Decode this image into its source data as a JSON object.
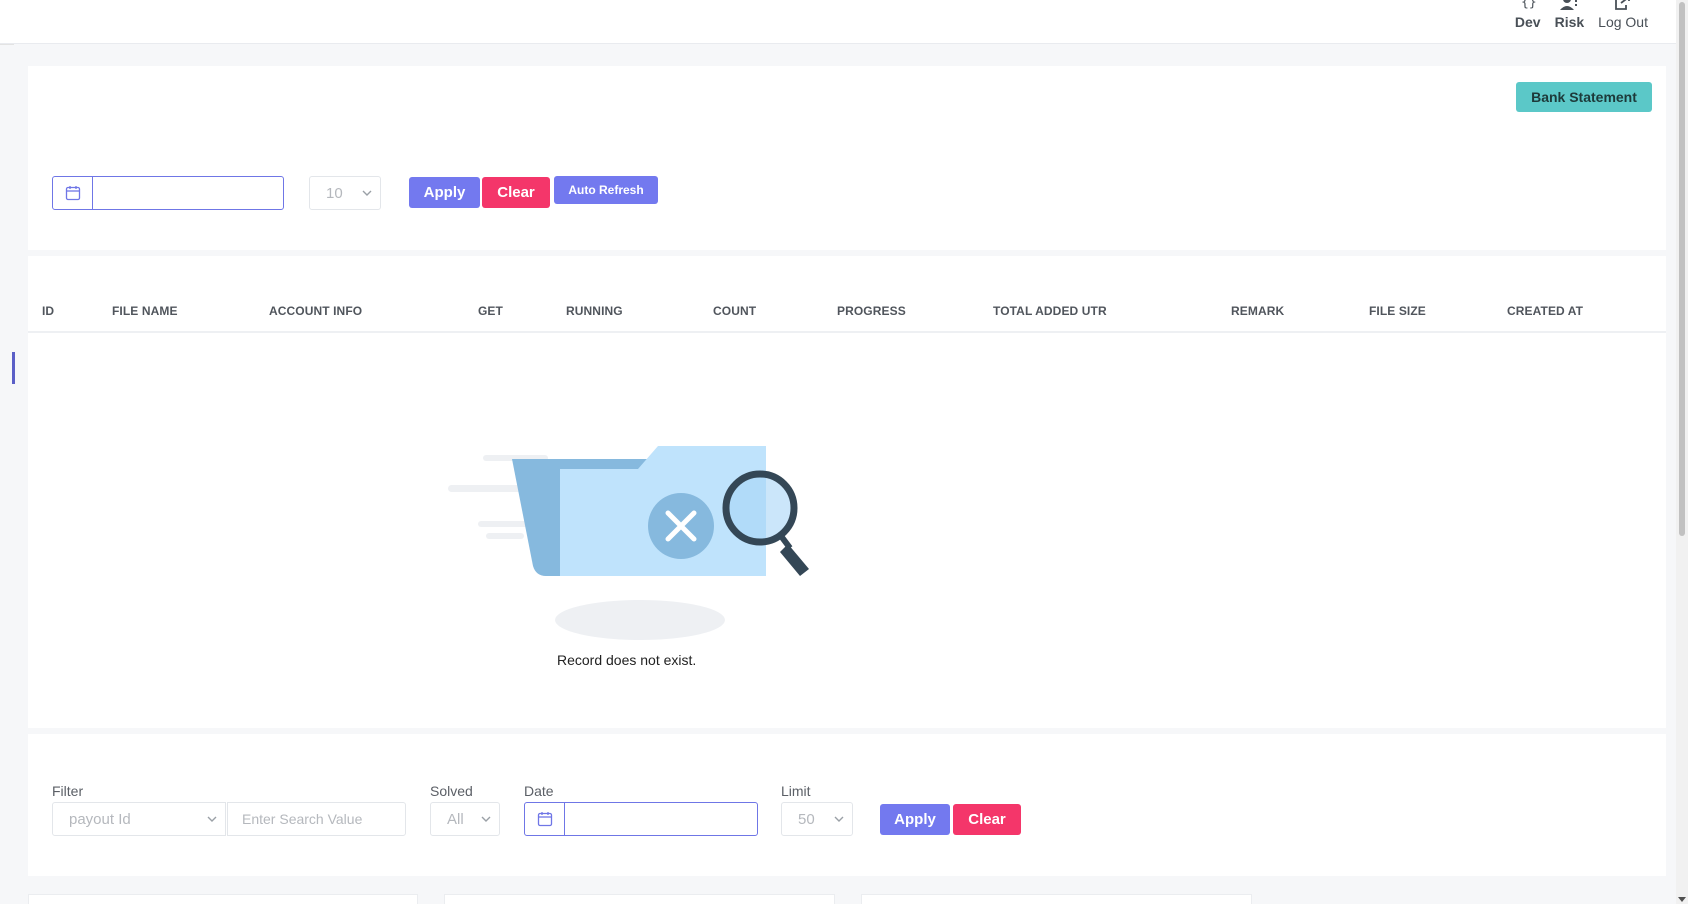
{
  "nav": {
    "items": [
      {
        "label": "Dev",
        "icon": "code-braces-icon"
      },
      {
        "label": "Risk",
        "icon": "user-alert-icon"
      },
      {
        "label": "Log Out",
        "icon": "logout-icon"
      }
    ]
  },
  "statement_card": {
    "bank_statement_label": "Bank Statement",
    "date_range_value": "",
    "limit_value": "10",
    "apply_label": "Apply",
    "clear_label": "Clear",
    "auto_refresh_label": "Auto Refresh"
  },
  "table": {
    "columns": [
      "ID",
      "FILE NAME",
      "ACCOUNT INFO",
      "GET",
      "RUNNING",
      "COUNT",
      "PROGRESS",
      "TOTAL ADDED UTR",
      "REMARK",
      "FILE SIZE",
      "CREATED AT"
    ],
    "rows": [],
    "empty_text": "Record does not exist."
  },
  "filters": {
    "filter_label": "Filter",
    "filter_select_value": "payout Id",
    "search_placeholder": "Enter Search Value",
    "solved_label": "Solved",
    "solved_value": "All",
    "date_label": "Date",
    "date_value": "",
    "limit_label": "Limit",
    "limit_value": "50",
    "apply_label": "Apply",
    "clear_label": "Clear"
  },
  "colors": {
    "primary": "#7379ef",
    "danger": "#f4366a",
    "teal": "#5bc8c8",
    "background": "#f6f7f9"
  }
}
